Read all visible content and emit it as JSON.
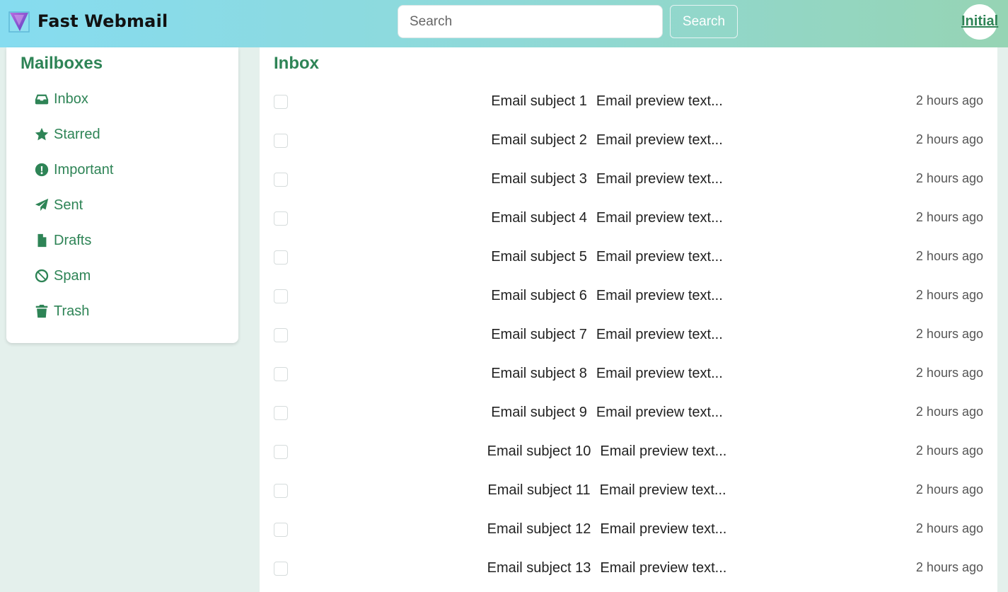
{
  "app": {
    "title": "Fast Webmail",
    "logo_icon": "v-logo-icon",
    "brand_color": "#2e8456"
  },
  "header": {
    "search_placeholder": "Search",
    "search_button_label": "Search",
    "avatar_label": "Initial"
  },
  "sidebar": {
    "title": "Mailboxes",
    "items": [
      {
        "label": "Inbox",
        "icon": "inbox-icon"
      },
      {
        "label": "Starred",
        "icon": "star-icon"
      },
      {
        "label": "Important",
        "icon": "exclamation-circle-icon"
      },
      {
        "label": "Sent",
        "icon": "paper-plane-icon"
      },
      {
        "label": "Drafts",
        "icon": "file-icon"
      },
      {
        "label": "Spam",
        "icon": "ban-icon"
      },
      {
        "label": "Trash",
        "icon": "trash-icon"
      }
    ]
  },
  "main": {
    "title": "Inbox",
    "emails": [
      {
        "subject": "Email subject 1",
        "preview": "Email preview text...",
        "time": "2 hours ago"
      },
      {
        "subject": "Email subject 2",
        "preview": "Email preview text...",
        "time": "2 hours ago"
      },
      {
        "subject": "Email subject 3",
        "preview": "Email preview text...",
        "time": "2 hours ago"
      },
      {
        "subject": "Email subject 4",
        "preview": "Email preview text...",
        "time": "2 hours ago"
      },
      {
        "subject": "Email subject 5",
        "preview": "Email preview text...",
        "time": "2 hours ago"
      },
      {
        "subject": "Email subject 6",
        "preview": "Email preview text...",
        "time": "2 hours ago"
      },
      {
        "subject": "Email subject 7",
        "preview": "Email preview text...",
        "time": "2 hours ago"
      },
      {
        "subject": "Email subject 8",
        "preview": "Email preview text...",
        "time": "2 hours ago"
      },
      {
        "subject": "Email subject 9",
        "preview": "Email preview text...",
        "time": "2 hours ago"
      },
      {
        "subject": "Email subject 10",
        "preview": "Email preview text...",
        "time": "2 hours ago"
      },
      {
        "subject": "Email subject 11",
        "preview": "Email preview text...",
        "time": "2 hours ago"
      },
      {
        "subject": "Email subject 12",
        "preview": "Email preview text...",
        "time": "2 hours ago"
      },
      {
        "subject": "Email subject 13",
        "preview": "Email preview text...",
        "time": "2 hours ago"
      }
    ]
  }
}
